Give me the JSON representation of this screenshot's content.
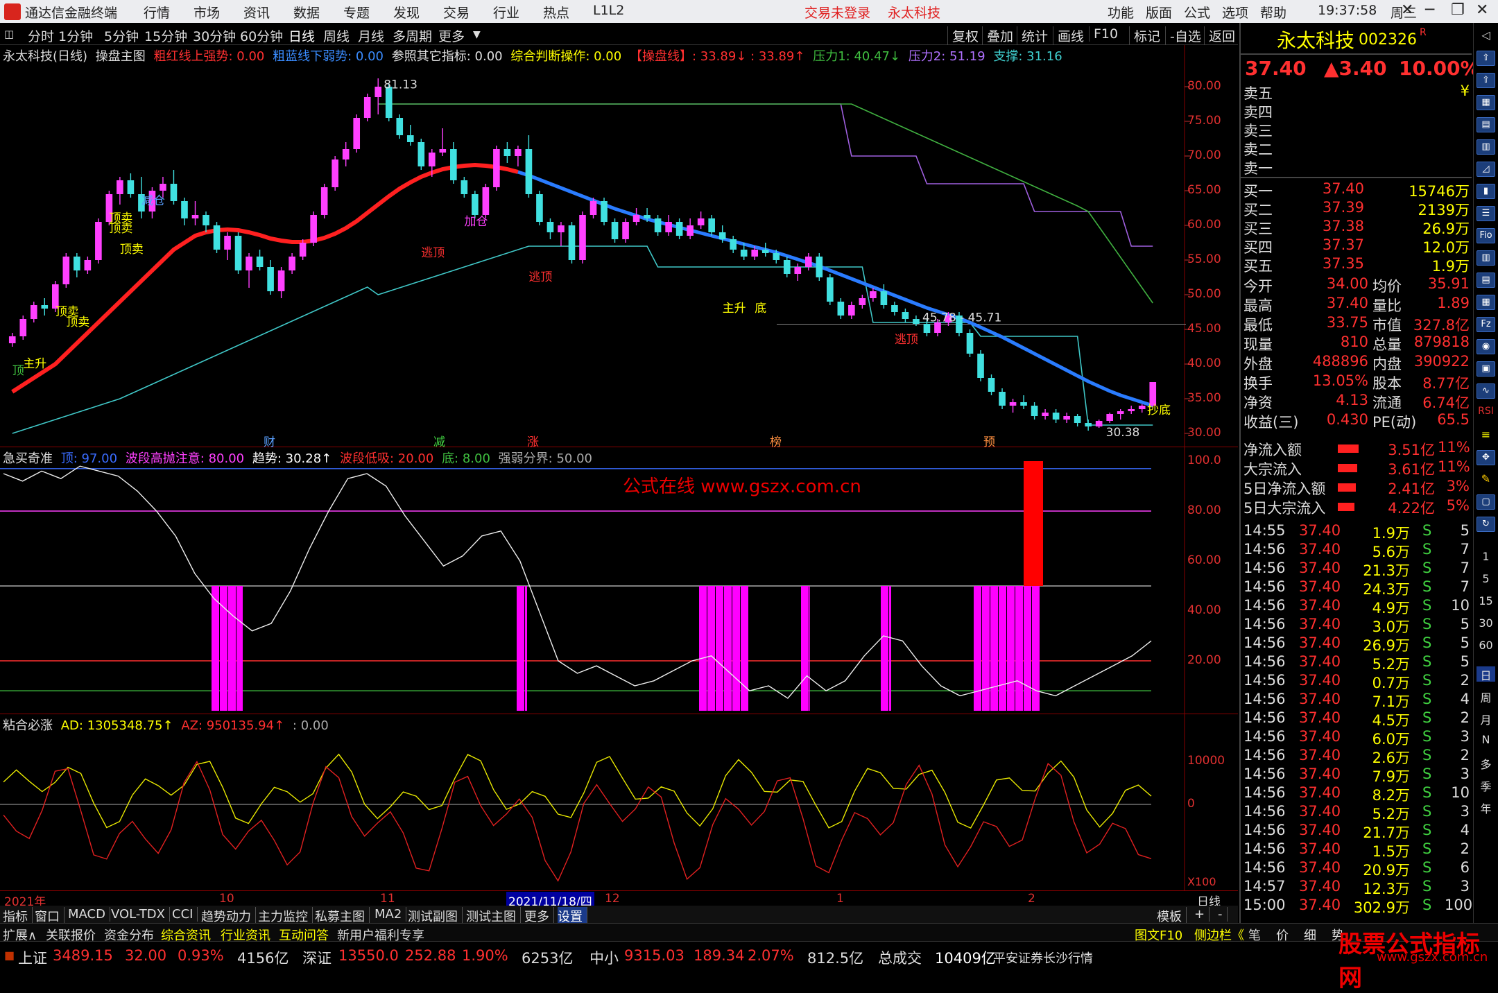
{
  "menubar": {
    "app_title": "通达信金融终端",
    "items": [
      "行情",
      "市场",
      "资讯",
      "数据",
      "专题",
      "发现",
      "交易",
      "行业",
      "热点",
      "L1L2"
    ],
    "notice_login": "交易未登录",
    "notice_stock": "永太科技",
    "right_items": [
      "功能",
      "版面",
      "公式",
      "选项",
      "帮助"
    ],
    "clock": "19:37:58",
    "weekday": "周三"
  },
  "toolbar": {
    "periods": [
      "分时",
      "1分钟",
      "5分钟",
      "15分钟",
      "30分钟",
      "60分钟",
      "日线",
      "周线",
      "月线",
      "多周期",
      "更多"
    ],
    "selected": "日线",
    "right_buttons": [
      "复权",
      "叠加",
      "统计",
      "画线",
      "F10",
      "标记",
      "-自选",
      "返回"
    ]
  },
  "main_chart": {
    "title": "永太科技(日线)",
    "formula": "操盘主图",
    "indicators": [
      {
        "label": "粗红线上强势: 0.00",
        "color": "#ff3030"
      },
      {
        "label": "粗蓝线下弱势: 0.00",
        "color": "#3a8cff"
      },
      {
        "label": "参照其它指标: 0.00",
        "color": "#e0e0e0"
      },
      {
        "label": "综合判断操作: 0.00",
        "color": "#ffff00"
      },
      {
        "label": "【操盘线】: 33.89↓ : 33.89↑",
        "color": "#ff3030"
      },
      {
        "label": "压力1: 40.47↓",
        "color": "#40c040"
      },
      {
        "label": "压力2: 51.19",
        "color": "#b070ff"
      },
      {
        "label": "支撑: 31.16",
        "color": "#40d0d0"
      }
    ],
    "y_ticks": [
      "80.00",
      "75.00",
      "70.00",
      "65.00",
      "60.00",
      "55.00",
      "50.00",
      "45.00",
      "40.00",
      "35.00",
      "30.00"
    ],
    "annotations": {
      "high": "81.13",
      "low": "30.38",
      "range": "45.78 - 45.71"
    },
    "event_markers": [
      "财",
      "减",
      "涨",
      "榜",
      "预"
    ],
    "signal_labels": [
      "顶卖",
      "减仓",
      "顶卖",
      "顶卖",
      "顶卖",
      "主升",
      "顶",
      "顶卖",
      "加仓",
      "逃顶",
      "逃顶",
      "主升",
      "底",
      "逃顶",
      "抄底"
    ]
  },
  "sub1": {
    "title": "急买奇准",
    "indicators": [
      {
        "label": "顶: 97.00",
        "color": "#3a6cff"
      },
      {
        "label": "波段高抛注意: 80.00",
        "color": "#ff40ff"
      },
      {
        "label": "趋势: 30.28↑",
        "color": "#ffffff"
      },
      {
        "label": "波段低吸: 20.00",
        "color": "#ff3030"
      },
      {
        "label": "底: 8.00",
        "color": "#40c040"
      },
      {
        "label": "强弱分界: 50.00",
        "color": "#aaaaaa"
      }
    ],
    "y_ticks": [
      "100.0",
      "80.00",
      "60.00",
      "40.00",
      "20.00"
    ],
    "watermark": "公式在线  www.gszx.com.cn"
  },
  "sub2": {
    "title": "粘合必涨",
    "indicators": [
      {
        "label": "AD: 1305348.75↑",
        "color": "#ffff00"
      },
      {
        "label": "AZ: 950135.94↑",
        "color": "#ff3030"
      },
      {
        "label": ": 0.00",
        "color": "#aaaaaa"
      }
    ],
    "y_ticks": [
      "10000",
      "0"
    ],
    "unit": "X100"
  },
  "time_axis": {
    "labels": [
      "2021年",
      "10",
      "11",
      "2021/11/18/四",
      "12",
      "1",
      "2"
    ],
    "period": "日线"
  },
  "bottom_tabs": [
    "指标",
    "窗口",
    "MACD",
    "VOL-TDX",
    "CCI",
    "趋势动力",
    "主力监控",
    "私募主图",
    "MA2",
    "测试副图",
    "测试主图",
    "更多",
    "设置"
  ],
  "bottom_tabs_right": [
    "模板",
    "+",
    "-"
  ],
  "bottom_tabs2": [
    "扩展∧",
    "关联报价",
    "资金分布",
    "综合资讯",
    "行业资讯",
    "互动问答",
    "新用户福利专享"
  ],
  "bottom_tabs2_right": [
    "图文F10",
    "侧边栏《",
    "笔",
    "价",
    "细",
    "势"
  ],
  "status_bar": {
    "sh_label": "上证",
    "sh_val": "3489.15",
    "sh_chg": "32.00",
    "sh_pct": "0.93%",
    "sh_amt": "4156亿",
    "sz_label": "深证",
    "sz_val": "13550.0",
    "sz_chg": "252.88",
    "sz_pct": "1.90%",
    "sz_amt": "6253亿",
    "zx_label": "中小",
    "zx_val": "9315.03",
    "zx_chg": "189.34",
    "zx_pct": "2.07%",
    "zx_amt": "812.5亿",
    "total_label": "总成交",
    "total_val": "10409亿",
    "broker": "平安证券长沙行情"
  },
  "quote": {
    "name": "永太科技",
    "code": "002326",
    "flag": "R",
    "price": "37.40",
    "change": "▲3.40",
    "pct": "10.00%",
    "sell": [
      {
        "l": "卖五",
        "p": "",
        "v": "¥"
      },
      {
        "l": "卖四",
        "p": "",
        "v": ""
      },
      {
        "l": "卖三",
        "p": "",
        "v": ""
      },
      {
        "l": "卖二",
        "p": "",
        "v": ""
      },
      {
        "l": "卖一",
        "p": "",
        "v": ""
      }
    ],
    "buy": [
      {
        "l": "买一",
        "p": "37.40",
        "v": "15746万"
      },
      {
        "l": "买二",
        "p": "37.39",
        "v": "2139万"
      },
      {
        "l": "买三",
        "p": "37.38",
        "v": "26.9万"
      },
      {
        "l": "买四",
        "p": "37.37",
        "v": "12.0万"
      },
      {
        "l": "买五",
        "p": "37.35",
        "v": "1.9万"
      }
    ],
    "stats": [
      {
        "a": "今开",
        "b": "34.00",
        "c": "均价",
        "d": "35.91"
      },
      {
        "a": "最高",
        "b": "37.40",
        "c": "量比",
        "d": "1.89"
      },
      {
        "a": "最低",
        "b": "33.75",
        "c": "市值",
        "d": "327.8亿"
      },
      {
        "a": "现量",
        "b": "810",
        "c": "总量",
        "d": "879818"
      },
      {
        "a": "外盘",
        "b": "488896",
        "c": "内盘",
        "d": "390922"
      },
      {
        "a": "换手",
        "b": "13.05%",
        "c": "股本",
        "d": "8.77亿"
      },
      {
        "a": "净资",
        "b": "4.13",
        "c": "流通",
        "d": "6.74亿"
      },
      {
        "a": "收益(三)",
        "b": "0.430",
        "c": "PE(动)",
        "d": "65.5"
      }
    ],
    "flows": [
      {
        "l": "净流入额",
        "v": "3.51亿",
        "p": "11%"
      },
      {
        "l": "大宗流入",
        "v": "3.61亿",
        "p": "11%"
      },
      {
        "l": "5日净流入额",
        "v": "2.41亿",
        "p": "3%"
      },
      {
        "l": "5日大宗流入",
        "v": "4.22亿",
        "p": "5%"
      }
    ],
    "ticks": [
      {
        "t": "14:55",
        "p": "37.40",
        "v": "1.9万",
        "s": "S",
        "n": "5"
      },
      {
        "t": "14:56",
        "p": "37.40",
        "v": "5.6万",
        "s": "S",
        "n": "7"
      },
      {
        "t": "14:56",
        "p": "37.40",
        "v": "21.3万",
        "s": "S",
        "n": "7"
      },
      {
        "t": "14:56",
        "p": "37.40",
        "v": "24.3万",
        "s": "S",
        "n": "7"
      },
      {
        "t": "14:56",
        "p": "37.40",
        "v": "4.9万",
        "s": "S",
        "n": "10"
      },
      {
        "t": "14:56",
        "p": "37.40",
        "v": "3.0万",
        "s": "S",
        "n": "5"
      },
      {
        "t": "14:56",
        "p": "37.40",
        "v": "26.9万",
        "s": "S",
        "n": "5"
      },
      {
        "t": "14:56",
        "p": "37.40",
        "v": "5.2万",
        "s": "S",
        "n": "5"
      },
      {
        "t": "14:56",
        "p": "37.40",
        "v": "0.7万",
        "s": "S",
        "n": "2"
      },
      {
        "t": "14:56",
        "p": "37.40",
        "v": "7.1万",
        "s": "S",
        "n": "4"
      },
      {
        "t": "14:56",
        "p": "37.40",
        "v": "4.5万",
        "s": "S",
        "n": "2"
      },
      {
        "t": "14:56",
        "p": "37.40",
        "v": "6.0万",
        "s": "S",
        "n": "3"
      },
      {
        "t": "14:56",
        "p": "37.40",
        "v": "2.6万",
        "s": "S",
        "n": "2"
      },
      {
        "t": "14:56",
        "p": "37.40",
        "v": "7.9万",
        "s": "S",
        "n": "3"
      },
      {
        "t": "14:56",
        "p": "37.40",
        "v": "8.2万",
        "s": "S",
        "n": "10"
      },
      {
        "t": "14:56",
        "p": "37.40",
        "v": "5.2万",
        "s": "S",
        "n": "3"
      },
      {
        "t": "14:56",
        "p": "37.40",
        "v": "21.7万",
        "s": "S",
        "n": "4"
      },
      {
        "t": "14:56",
        "p": "37.40",
        "v": "1.5万",
        "s": "S",
        "n": "2"
      },
      {
        "t": "14:56",
        "p": "37.40",
        "v": "20.9万",
        "s": "S",
        "n": "6"
      },
      {
        "t": "14:57",
        "p": "37.40",
        "v": "12.3万",
        "s": "S",
        "n": "3"
      },
      {
        "t": "15:00",
        "p": "37.40",
        "v": "302.9万",
        "s": "S",
        "n": "100"
      }
    ]
  },
  "side_tabs": [
    "日",
    "周",
    "月",
    "N",
    "多",
    "季",
    "年"
  ],
  "side_minutes": [
    "1",
    "5",
    "15",
    "30",
    "60"
  ],
  "side_icon_labels": [
    "RSI",
    "≡",
    "Fio",
    "Fz"
  ],
  "watermark": {
    "big": "股票公式指标网",
    "small": "www.gszx.com.cn"
  },
  "chart_data": {
    "type": "candlestick",
    "ylim": [
      29,
      82
    ],
    "candles": [
      [
        43.0,
        44.5,
        42.5,
        44.0
      ],
      [
        44.0,
        47.0,
        43.5,
        46.5
      ],
      [
        46.5,
        49.0,
        46.0,
        48.5
      ],
      [
        48.5,
        49.5,
        47.0,
        48.0
      ],
      [
        48.0,
        52.0,
        47.5,
        51.5
      ],
      [
        51.5,
        56.0,
        51.0,
        55.5
      ],
      [
        55.5,
        56.0,
        52.5,
        53.5
      ],
      [
        53.5,
        55.5,
        53.0,
        55.0
      ],
      [
        55.0,
        61.0,
        54.5,
        60.5
      ],
      [
        60.5,
        65.0,
        60.0,
        64.5
      ],
      [
        64.5,
        67.0,
        63.0,
        66.5
      ],
      [
        66.5,
        67.5,
        64.0,
        64.5
      ],
      [
        64.5,
        67.0,
        61.0,
        62.0
      ],
      [
        62.0,
        65.5,
        61.0,
        65.0
      ],
      [
        65.0,
        67.0,
        64.0,
        66.0
      ],
      [
        66.0,
        68.0,
        63.0,
        63.5
      ],
      [
        63.5,
        64.0,
        60.0,
        61.0
      ],
      [
        61.0,
        63.5,
        60.0,
        61.5
      ],
      [
        61.5,
        62.0,
        59.0,
        60.0
      ],
      [
        60.0,
        60.5,
        56.0,
        56.5
      ],
      [
        56.5,
        59.0,
        55.0,
        58.5
      ],
      [
        58.5,
        59.0,
        53.0,
        53.5
      ],
      [
        53.5,
        56.0,
        51.0,
        55.5
      ],
      [
        55.5,
        56.5,
        53.5,
        54.0
      ],
      [
        54.0,
        55.0,
        50.0,
        50.5
      ],
      [
        50.5,
        54.0,
        49.5,
        53.5
      ],
      [
        53.5,
        56.0,
        53.0,
        55.5
      ],
      [
        55.5,
        58.0,
        55.0,
        57.5
      ],
      [
        57.5,
        62.0,
        57.0,
        61.5
      ],
      [
        61.5,
        66.0,
        61.0,
        65.5
      ],
      [
        65.5,
        70.0,
        65.0,
        69.5
      ],
      [
        69.5,
        72.0,
        68.5,
        71.0
      ],
      [
        71.0,
        76.0,
        70.5,
        75.5
      ],
      [
        75.5,
        79.0,
        75.0,
        78.5
      ],
      [
        78.5,
        81.2,
        76.0,
        80.0
      ],
      [
        80.0,
        80.5,
        75.0,
        75.5
      ],
      [
        75.5,
        76.0,
        72.5,
        73.0
      ],
      [
        73.0,
        74.5,
        71.5,
        72.0
      ],
      [
        72.0,
        72.5,
        68.0,
        68.5
      ],
      [
        68.5,
        71.0,
        67.0,
        70.5
      ],
      [
        70.5,
        74.0,
        70.0,
        71.0
      ],
      [
        71.0,
        72.0,
        66.0,
        66.5
      ],
      [
        66.5,
        67.0,
        64.0,
        64.5
      ],
      [
        64.5,
        65.0,
        61.0,
        61.5
      ],
      [
        61.5,
        66.0,
        61.0,
        65.5
      ],
      [
        65.5,
        71.5,
        65.0,
        71.0
      ],
      [
        71.0,
        72.0,
        69.0,
        70.0
      ],
      [
        70.0,
        71.5,
        68.5,
        71.0
      ],
      [
        71.0,
        73.0,
        64.0,
        64.5
      ],
      [
        64.5,
        65.0,
        60.0,
        60.5
      ],
      [
        60.5,
        61.0,
        58.0,
        59.0
      ],
      [
        59.0,
        60.5,
        57.0,
        60.0
      ],
      [
        60.0,
        60.5,
        54.5,
        55.0
      ],
      [
        55.0,
        62.0,
        54.5,
        61.5
      ],
      [
        61.5,
        64.0,
        61.0,
        63.5
      ],
      [
        63.5,
        64.0,
        60.0,
        60.5
      ],
      [
        60.5,
        61.0,
        57.5,
        58.0
      ],
      [
        58.0,
        61.0,
        57.5,
        60.5
      ],
      [
        60.5,
        62.5,
        60.0,
        61.5
      ],
      [
        61.5,
        62.5,
        60.5,
        61.0
      ],
      [
        61.0,
        61.5,
        58.5,
        59.0
      ],
      [
        59.0,
        61.5,
        58.5,
        60.5
      ],
      [
        60.5,
        61.0,
        58.0,
        58.5
      ],
      [
        58.5,
        61.0,
        58.0,
        60.0
      ],
      [
        60.0,
        62.0,
        59.5,
        61.0
      ],
      [
        61.0,
        61.5,
        58.5,
        59.0
      ],
      [
        59.0,
        60.0,
        57.5,
        58.0
      ],
      [
        58.0,
        58.5,
        56.0,
        56.5
      ],
      [
        56.5,
        57.5,
        55.0,
        55.5
      ],
      [
        55.5,
        57.0,
        55.0,
        56.5
      ],
      [
        56.5,
        57.5,
        55.5,
        56.0
      ],
      [
        56.0,
        56.5,
        54.5,
        55.0
      ],
      [
        55.0,
        55.5,
        52.5,
        53.0
      ],
      [
        53.0,
        54.5,
        52.0,
        54.0
      ],
      [
        54.0,
        56.0,
        53.5,
        55.5
      ],
      [
        55.5,
        56.0,
        52.0,
        52.5
      ],
      [
        52.5,
        53.0,
        48.5,
        49.0
      ],
      [
        49.0,
        49.5,
        46.5,
        47.0
      ],
      [
        47.0,
        49.0,
        46.5,
        48.5
      ],
      [
        48.5,
        50.0,
        48.0,
        49.5
      ],
      [
        49.5,
        51.0,
        49.0,
        50.5
      ],
      [
        50.5,
        51.5,
        48.0,
        48.5
      ],
      [
        48.5,
        49.0,
        47.0,
        47.5
      ],
      [
        47.5,
        48.0,
        46.0,
        46.5
      ],
      [
        46.5,
        47.0,
        45.5,
        45.8
      ],
      [
        45.8,
        46.5,
        44.0,
        44.5
      ],
      [
        44.5,
        46.5,
        44.0,
        46.0
      ],
      [
        46.0,
        47.5,
        45.5,
        47.0
      ],
      [
        47.0,
        47.5,
        44.0,
        44.5
      ],
      [
        44.5,
        45.0,
        41.0,
        41.5
      ],
      [
        41.5,
        42.0,
        37.5,
        38.0
      ],
      [
        38.0,
        38.5,
        35.5,
        36.0
      ],
      [
        36.0,
        36.5,
        33.5,
        34.0
      ],
      [
        34.0,
        35.0,
        33.0,
        34.5
      ],
      [
        34.5,
        35.5,
        33.5,
        34.0
      ],
      [
        34.0,
        34.5,
        32.0,
        32.5
      ],
      [
        32.5,
        33.5,
        32.0,
        33.0
      ],
      [
        33.0,
        33.5,
        31.5,
        32.0
      ],
      [
        32.0,
        33.0,
        31.5,
        32.5
      ],
      [
        32.5,
        32.8,
        31.0,
        31.5
      ],
      [
        31.5,
        32.0,
        30.4,
        31.0
      ],
      [
        31.0,
        32.0,
        30.8,
        31.8
      ],
      [
        31.8,
        33.0,
        31.5,
        32.8
      ],
      [
        32.8,
        33.5,
        32.0,
        33.2
      ],
      [
        33.2,
        34.0,
        32.8,
        33.5
      ],
      [
        33.5,
        34.2,
        33.0,
        34.0
      ],
      [
        34.0,
        37.4,
        33.75,
        37.4
      ]
    ],
    "ma_line": [
      36,
      37,
      38,
      39,
      40,
      41.5,
      43,
      44.5,
      46,
      47.5,
      49,
      50.5,
      52,
      53.5,
      55,
      56.5,
      57.5,
      58.5,
      59,
      59.3,
      59.4,
      59.3,
      59,
      58.6,
      58.1,
      57.8,
      57.6,
      57.6,
      57.8,
      58.2,
      58.8,
      59.6,
      60.6,
      61.8,
      63,
      64.2,
      65.3,
      66.2,
      67,
      67.6,
      68.1,
      68.4,
      68.6,
      68.7,
      68.6,
      68.4,
      68.1,
      67.7,
      67.2,
      66.6,
      66,
      65.4,
      64.8,
      64.2,
      63.6,
      63,
      62.4,
      61.9,
      61.4,
      60.9,
      60.5,
      60.1,
      59.7,
      59.3,
      58.9,
      58.5,
      58.1,
      57.7,
      57.3,
      56.9,
      56.5,
      56.1,
      55.6,
      55.1,
      54.6,
      54.1,
      53.5,
      52.9,
      52.3,
      51.7,
      51.1,
      50.5,
      49.9,
      49.3,
      48.7,
      48.1,
      47.6,
      47.1,
      46.6,
      46.0,
      45.3,
      44.6,
      43.9,
      43.1,
      42.3,
      41.5,
      40.7,
      39.9,
      39.1,
      38.3,
      37.5,
      36.8,
      36.1,
      35.5,
      35.0,
      34.5,
      34.0
    ]
  }
}
